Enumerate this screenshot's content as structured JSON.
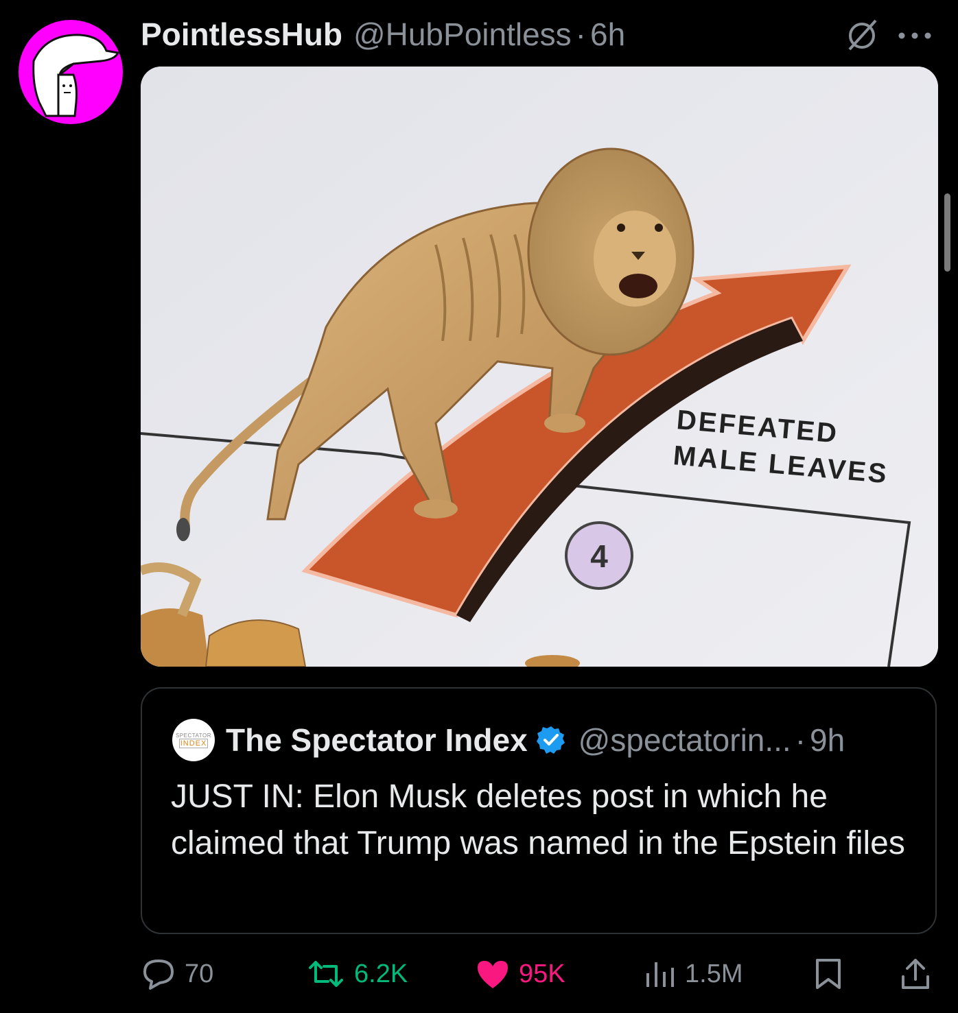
{
  "post": {
    "author_name": "PointlessHub",
    "author_handle": "@HubPointless",
    "separator": "·",
    "time": "6h",
    "image": {
      "arrow_number": "4",
      "label_line1": "DEFEATED",
      "label_line2": "MALE LEAVES"
    }
  },
  "quote": {
    "avatar_line1": "SPECTATOR",
    "avatar_line2": "INDEX",
    "author_name": "The Spectator Index",
    "author_handle": "@spectatorin...",
    "separator": "·",
    "time": "9h",
    "text": "JUST IN: Elon Musk deletes post in which he claimed that Trump was named in the Epstein files"
  },
  "actions": {
    "replies": "70",
    "reposts": "6.2K",
    "likes": "95K",
    "views": "1.5M"
  },
  "colors": {
    "background": "#000000",
    "avatar": "#ff00ff",
    "repost": "#00ba7c",
    "like": "#f91880",
    "verified": "#1d9bf0",
    "muted": "#8b9198"
  },
  "icons": [
    "grok-icon",
    "more-icon",
    "verified-icon",
    "reply-icon",
    "retweet-icon",
    "heart-icon",
    "views-icon",
    "bookmark-icon",
    "share-icon"
  ]
}
